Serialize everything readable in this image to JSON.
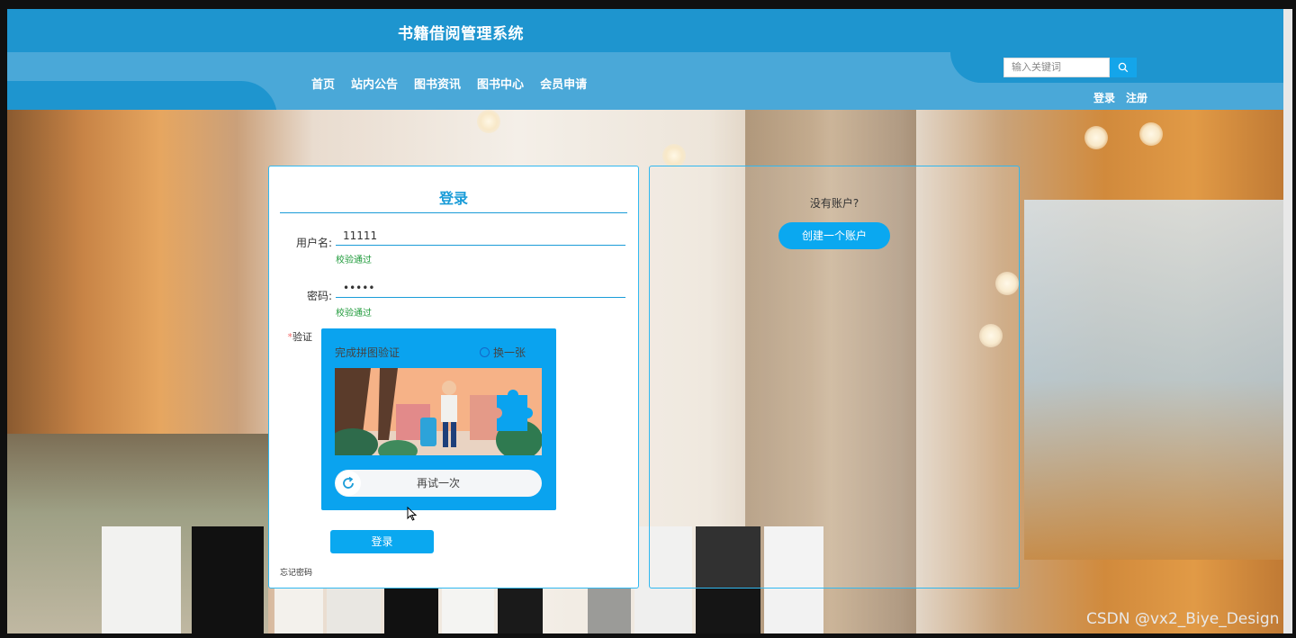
{
  "header": {
    "title": "书籍借阅管理系统",
    "nav": [
      "首页",
      "站内公告",
      "图书资讯",
      "图书中心",
      "会员申请"
    ],
    "search_placeholder": "输入关键词",
    "login": "登录",
    "register": "注册"
  },
  "login_form": {
    "heading": "登录",
    "username_label": "用户名:",
    "username_value": "11111",
    "username_status": "校验通过",
    "password_label": "密码:",
    "password_value": "•••••",
    "password_status": "校验通过",
    "verify_required_mark": "*",
    "verify_label": "验证",
    "captcha_title": "完成拼图验证",
    "captcha_refresh": "换一张",
    "slider_text": "再试一次",
    "submit": "登录",
    "forgot": "忘记密码"
  },
  "register_panel": {
    "question": "没有账户?",
    "create_button": "创建一个账户"
  },
  "watermark": "CSDN @vx2_Biye_Design",
  "colors": {
    "header_blue": "#1e95cf",
    "accent": "#0aa8f0",
    "success": "#1e9a3a"
  }
}
